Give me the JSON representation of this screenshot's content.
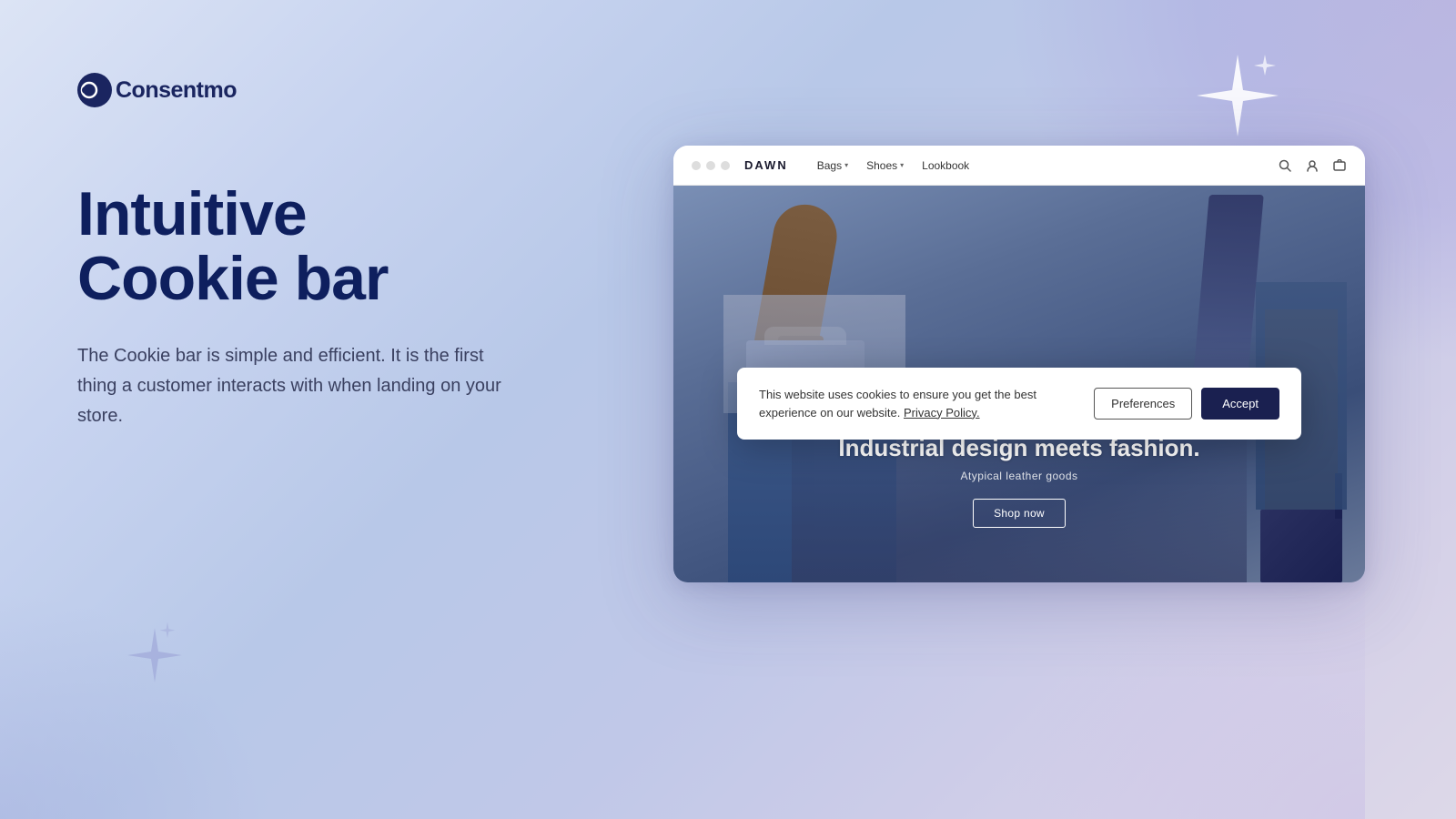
{
  "logo": {
    "icon_text": "C",
    "text": "onsentmo"
  },
  "heading": {
    "line1": "Intuitive",
    "line2": "Cookie bar"
  },
  "description": "The Cookie bar is simple and efficient. It is the first thing a customer interacts with when landing on your store.",
  "browser": {
    "site_name": "DAWN",
    "nav_items": [
      {
        "label": "Bags",
        "has_dropdown": true
      },
      {
        "label": "Shoes",
        "has_dropdown": true
      },
      {
        "label": "Lookbook",
        "has_dropdown": false
      }
    ]
  },
  "hero": {
    "headline": "Industrial design meets fashion.",
    "subline": "Atypical leather goods",
    "shop_now": "Shop now"
  },
  "cookie": {
    "message": "This website uses cookies to ensure you get the best experience on our website.",
    "privacy_link": "Privacy Policy.",
    "preferences_btn": "Preferences",
    "accept_btn": "Accept"
  }
}
